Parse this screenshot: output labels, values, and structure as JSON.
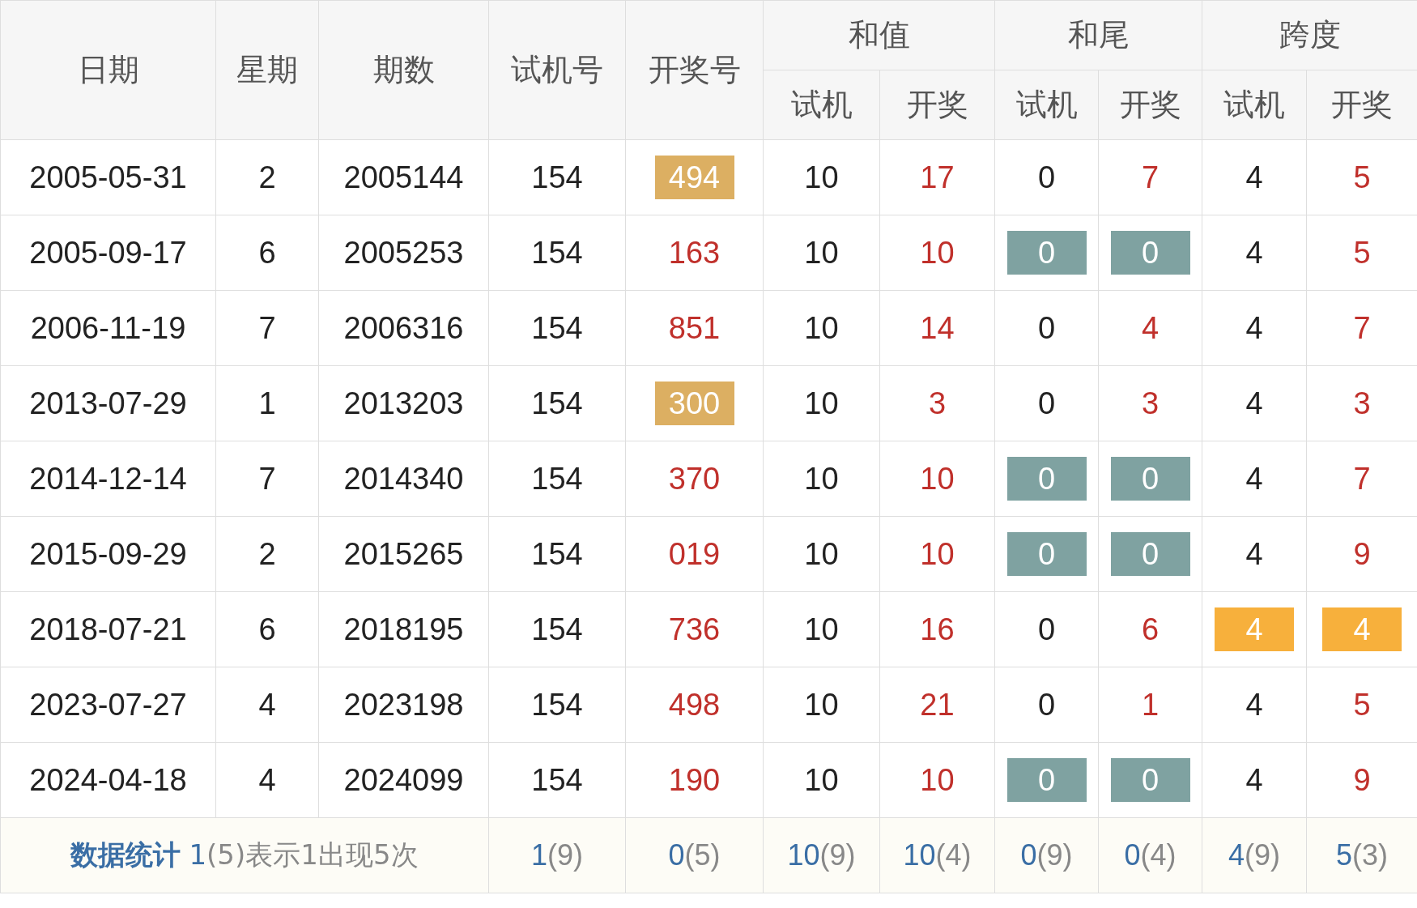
{
  "header": [
    {
      "label": "日期"
    },
    {
      "label": "星期"
    },
    {
      "label": "期数"
    },
    {
      "label": "试机号"
    },
    {
      "label": "开奖号"
    },
    {
      "label": "和值",
      "sub": [
        {
          "label": "试机"
        },
        {
          "label": "开奖"
        }
      ]
    },
    {
      "label": "和尾",
      "sub": [
        {
          "label": "试机"
        },
        {
          "label": "开奖"
        }
      ]
    },
    {
      "label": "跨度",
      "sub": [
        {
          "label": "试机"
        },
        {
          "label": "开奖"
        }
      ]
    }
  ],
  "rows": [
    {
      "cells": [
        {
          "text": "2005-05-31",
          "kind": "plain"
        },
        {
          "text": "2",
          "kind": "plain"
        },
        {
          "text": "2005144",
          "kind": "plain"
        },
        {
          "text": "154",
          "kind": "plain"
        },
        {
          "text": "494",
          "kind": "draw",
          "color": "#dcaf62"
        },
        {
          "text": "10",
          "kind": "plain"
        },
        {
          "text": "17",
          "kind": "draw"
        },
        {
          "text": "0",
          "kind": "plain"
        },
        {
          "text": "7",
          "kind": "draw"
        },
        {
          "text": "4",
          "kind": "plain"
        },
        {
          "text": "5",
          "kind": "draw"
        }
      ]
    },
    {
      "cells": [
        {
          "text": "2005-09-17",
          "kind": "plain"
        },
        {
          "text": "6",
          "kind": "plain"
        },
        {
          "text": "2005253",
          "kind": "plain"
        },
        {
          "text": "154",
          "kind": "plain"
        },
        {
          "text": "163",
          "kind": "draw"
        },
        {
          "text": "10",
          "kind": "plain"
        },
        {
          "text": "10",
          "kind": "draw"
        },
        {
          "text": "0",
          "kind": "plain",
          "color": "#7fa2a1"
        },
        {
          "text": "0",
          "kind": "draw",
          "color": "#7fa2a1"
        },
        {
          "text": "4",
          "kind": "plain"
        },
        {
          "text": "5",
          "kind": "draw"
        }
      ]
    },
    {
      "cells": [
        {
          "text": "2006-11-19",
          "kind": "plain"
        },
        {
          "text": "7",
          "kind": "plain"
        },
        {
          "text": "2006316",
          "kind": "plain"
        },
        {
          "text": "154",
          "kind": "plain"
        },
        {
          "text": "851",
          "kind": "draw"
        },
        {
          "text": "10",
          "kind": "plain"
        },
        {
          "text": "14",
          "kind": "draw"
        },
        {
          "text": "0",
          "kind": "plain"
        },
        {
          "text": "4",
          "kind": "draw"
        },
        {
          "text": "4",
          "kind": "plain"
        },
        {
          "text": "7",
          "kind": "draw"
        }
      ]
    },
    {
      "cells": [
        {
          "text": "2013-07-29",
          "kind": "plain"
        },
        {
          "text": "1",
          "kind": "plain"
        },
        {
          "text": "2013203",
          "kind": "plain"
        },
        {
          "text": "154",
          "kind": "plain"
        },
        {
          "text": "300",
          "kind": "draw",
          "color": "#dcaf62"
        },
        {
          "text": "10",
          "kind": "plain"
        },
        {
          "text": "3",
          "kind": "draw"
        },
        {
          "text": "0",
          "kind": "plain"
        },
        {
          "text": "3",
          "kind": "draw"
        },
        {
          "text": "4",
          "kind": "plain"
        },
        {
          "text": "3",
          "kind": "draw"
        }
      ]
    },
    {
      "cells": [
        {
          "text": "2014-12-14",
          "kind": "plain"
        },
        {
          "text": "7",
          "kind": "plain"
        },
        {
          "text": "2014340",
          "kind": "plain"
        },
        {
          "text": "154",
          "kind": "plain"
        },
        {
          "text": "370",
          "kind": "draw"
        },
        {
          "text": "10",
          "kind": "plain"
        },
        {
          "text": "10",
          "kind": "draw"
        },
        {
          "text": "0",
          "kind": "plain",
          "color": "#7fa2a1"
        },
        {
          "text": "0",
          "kind": "draw",
          "color": "#7fa2a1"
        },
        {
          "text": "4",
          "kind": "plain"
        },
        {
          "text": "7",
          "kind": "draw"
        }
      ]
    },
    {
      "cells": [
        {
          "text": "2015-09-29",
          "kind": "plain"
        },
        {
          "text": "2",
          "kind": "plain"
        },
        {
          "text": "2015265",
          "kind": "plain"
        },
        {
          "text": "154",
          "kind": "plain"
        },
        {
          "text": "019",
          "kind": "draw"
        },
        {
          "text": "10",
          "kind": "plain"
        },
        {
          "text": "10",
          "kind": "draw"
        },
        {
          "text": "0",
          "kind": "plain",
          "color": "#7fa2a1"
        },
        {
          "text": "0",
          "kind": "draw",
          "color": "#7fa2a1"
        },
        {
          "text": "4",
          "kind": "plain"
        },
        {
          "text": "9",
          "kind": "draw"
        }
      ]
    },
    {
      "cells": [
        {
          "text": "2018-07-21",
          "kind": "plain"
        },
        {
          "text": "6",
          "kind": "plain"
        },
        {
          "text": "2018195",
          "kind": "plain"
        },
        {
          "text": "154",
          "kind": "plain"
        },
        {
          "text": "736",
          "kind": "draw"
        },
        {
          "text": "10",
          "kind": "plain"
        },
        {
          "text": "16",
          "kind": "draw"
        },
        {
          "text": "0",
          "kind": "plain"
        },
        {
          "text": "6",
          "kind": "draw"
        },
        {
          "text": "4",
          "kind": "plain",
          "color": "#f7b03c"
        },
        {
          "text": "4",
          "kind": "draw",
          "color": "#f7b03c"
        }
      ]
    },
    {
      "cells": [
        {
          "text": "2023-07-27",
          "kind": "plain"
        },
        {
          "text": "4",
          "kind": "plain"
        },
        {
          "text": "2023198",
          "kind": "plain"
        },
        {
          "text": "154",
          "kind": "plain"
        },
        {
          "text": "498",
          "kind": "draw"
        },
        {
          "text": "10",
          "kind": "plain"
        },
        {
          "text": "21",
          "kind": "draw"
        },
        {
          "text": "0",
          "kind": "plain"
        },
        {
          "text": "1",
          "kind": "draw"
        },
        {
          "text": "4",
          "kind": "plain"
        },
        {
          "text": "5",
          "kind": "draw"
        }
      ]
    },
    {
      "cells": [
        {
          "text": "2024-04-18",
          "kind": "plain"
        },
        {
          "text": "4",
          "kind": "plain"
        },
        {
          "text": "2024099",
          "kind": "plain"
        },
        {
          "text": "154",
          "kind": "plain"
        },
        {
          "text": "190",
          "kind": "draw"
        },
        {
          "text": "10",
          "kind": "plain"
        },
        {
          "text": "10",
          "kind": "draw"
        },
        {
          "text": "0",
          "kind": "plain",
          "color": "#7fa2a1"
        },
        {
          "text": "0",
          "kind": "draw",
          "color": "#7fa2a1"
        },
        {
          "text": "4",
          "kind": "plain"
        },
        {
          "text": "9",
          "kind": "draw"
        }
      ]
    }
  ],
  "summary": {
    "title": "数据统计",
    "note": {
      "value": "1",
      "rest": "(5)表示1出现5次"
    },
    "cells": [
      {
        "value": "1",
        "count": "(9)"
      },
      {
        "value": "0",
        "count": "(5)"
      },
      {
        "value": "10",
        "count": "(9)"
      },
      {
        "value": "10",
        "count": "(4)"
      },
      {
        "value": "0",
        "count": "(9)"
      },
      {
        "value": "0",
        "count": "(4)"
      },
      {
        "value": "4",
        "count": "(9)"
      },
      {
        "value": "5",
        "count": "(3)"
      }
    ]
  }
}
